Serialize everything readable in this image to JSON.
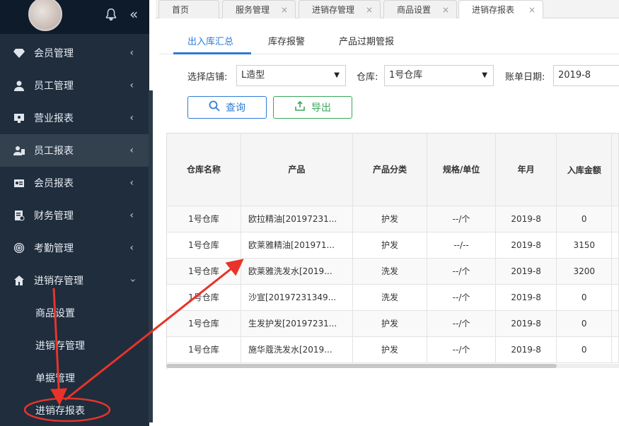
{
  "sidebar": {
    "items": [
      {
        "label": "会员管理",
        "icon": "diamond-icon"
      },
      {
        "label": "员工管理",
        "icon": "user-icon"
      },
      {
        "label": "营业报表",
        "icon": "monitor-icon"
      },
      {
        "label": "员工报表",
        "icon": "user-card-icon"
      },
      {
        "label": "会员报表",
        "icon": "id-card-icon"
      },
      {
        "label": "财务管理",
        "icon": "finance-doc-icon"
      },
      {
        "label": "考勤管理",
        "icon": "fingerprint-icon"
      },
      {
        "label": "进销存管理",
        "icon": "home-icon"
      }
    ],
    "submenu": [
      {
        "label": "商品设置"
      },
      {
        "label": "进销存管理"
      },
      {
        "label": "单据管理"
      },
      {
        "label": "进销存报表"
      }
    ]
  },
  "tabs": [
    {
      "label": "首页"
    },
    {
      "label": "服务管理"
    },
    {
      "label": "进销存管理"
    },
    {
      "label": "商品设置"
    },
    {
      "label": "进销存报表"
    }
  ],
  "subtabs": [
    {
      "label": "出入库汇总"
    },
    {
      "label": "库存报警"
    },
    {
      "label": "产品过期管报"
    }
  ],
  "filters": {
    "store_label": "选择店铺:",
    "store_value": "L造型",
    "warehouse_label": "仓库:",
    "warehouse_value": "1号仓库",
    "date_label": "账单日期:",
    "date_value": "2019-8"
  },
  "buttons": {
    "query": "查询",
    "export": "导出"
  },
  "table": {
    "headers": [
      "仓库名称",
      "产品",
      "产品分类",
      "规格/单位",
      "年月",
      "入库金额"
    ],
    "rows": [
      [
        "1号仓库",
        "欧拉精油[20197231...",
        "护发",
        "--/个",
        "2019-8",
        "0"
      ],
      [
        "1号仓库",
        "欧莱雅精油[201971...",
        "护发",
        "--/--",
        "2019-8",
        "3150"
      ],
      [
        "1号仓库",
        "欧莱雅洗发水[2019...",
        "洗发",
        "--/个",
        "2019-8",
        "3200"
      ],
      [
        "1号仓库",
        "沙宣[20197231349...",
        "洗发",
        "--/个",
        "2019-8",
        "0"
      ],
      [
        "1号仓库",
        "生发护发[20197231...",
        "护发",
        "--/个",
        "2019-8",
        "0"
      ],
      [
        "1号仓库",
        "施华蔻洗发水[2019...",
        "护发",
        "--/个",
        "2019-8",
        "0"
      ]
    ]
  },
  "colors": {
    "accent": "#2d7cd6",
    "export_green": "#3aa75a",
    "sidebar_bg": "#1f2d3d",
    "annotation_red": "#e8332a"
  }
}
